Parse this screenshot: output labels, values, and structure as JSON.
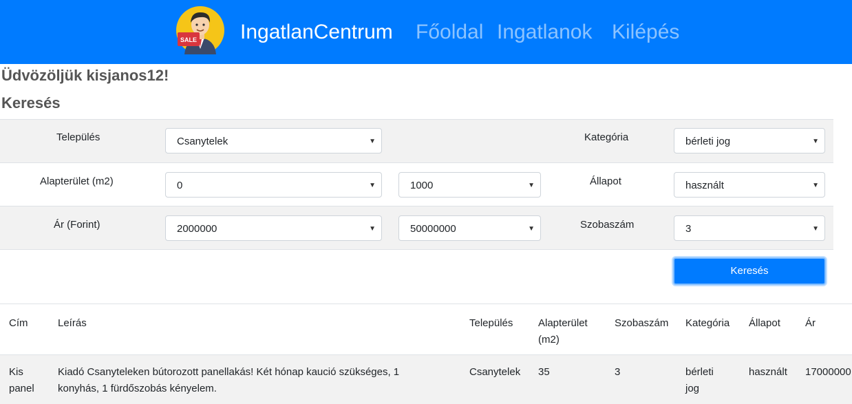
{
  "navbar": {
    "logo_text": "SALE",
    "brand": "IngatlanCentrum",
    "links": [
      "Főoldal",
      "Ingatlanok",
      "Kilépés"
    ]
  },
  "welcome": "Üdvözöljük kisjanos12!",
  "search": {
    "title": "Keresés",
    "settlement_label": "Település",
    "settlement_value": "Csanytelek",
    "category_label": "Kategória",
    "category_value": "bérleti jog",
    "area_label": "Alapterület (m2)",
    "area_min": "0",
    "area_max": "1000",
    "condition_label": "Állapot",
    "condition_value": "használt",
    "price_label": "Ár (Forint)",
    "price_min": "2000000",
    "price_max": "50000000",
    "rooms_label": "Szobaszám",
    "rooms_value": "3",
    "button": "Keresés"
  },
  "table": {
    "headers": {
      "address": "Cím",
      "description": "Leírás",
      "settlement": "Település",
      "area_line1": "Alapterület",
      "area_line2": "(m2)",
      "rooms": "Szobaszám",
      "category": "Kategória",
      "condition": "Állapot",
      "price": "Ár"
    },
    "rows": [
      {
        "address_line1": "Kis",
        "address_line2": "panel",
        "description_line1": "Kiadó Csanyteleken bútorozott panellakás! Két hónap kaució szükséges, 1",
        "description_line2": "konyhás, 1 fürdőszobás kényelem.",
        "settlement": "Csanytelek",
        "area": "35",
        "rooms": "3",
        "category_line1": "bérleti",
        "category_line2": "jog",
        "condition": "használt",
        "price": "17000000"
      }
    ]
  }
}
